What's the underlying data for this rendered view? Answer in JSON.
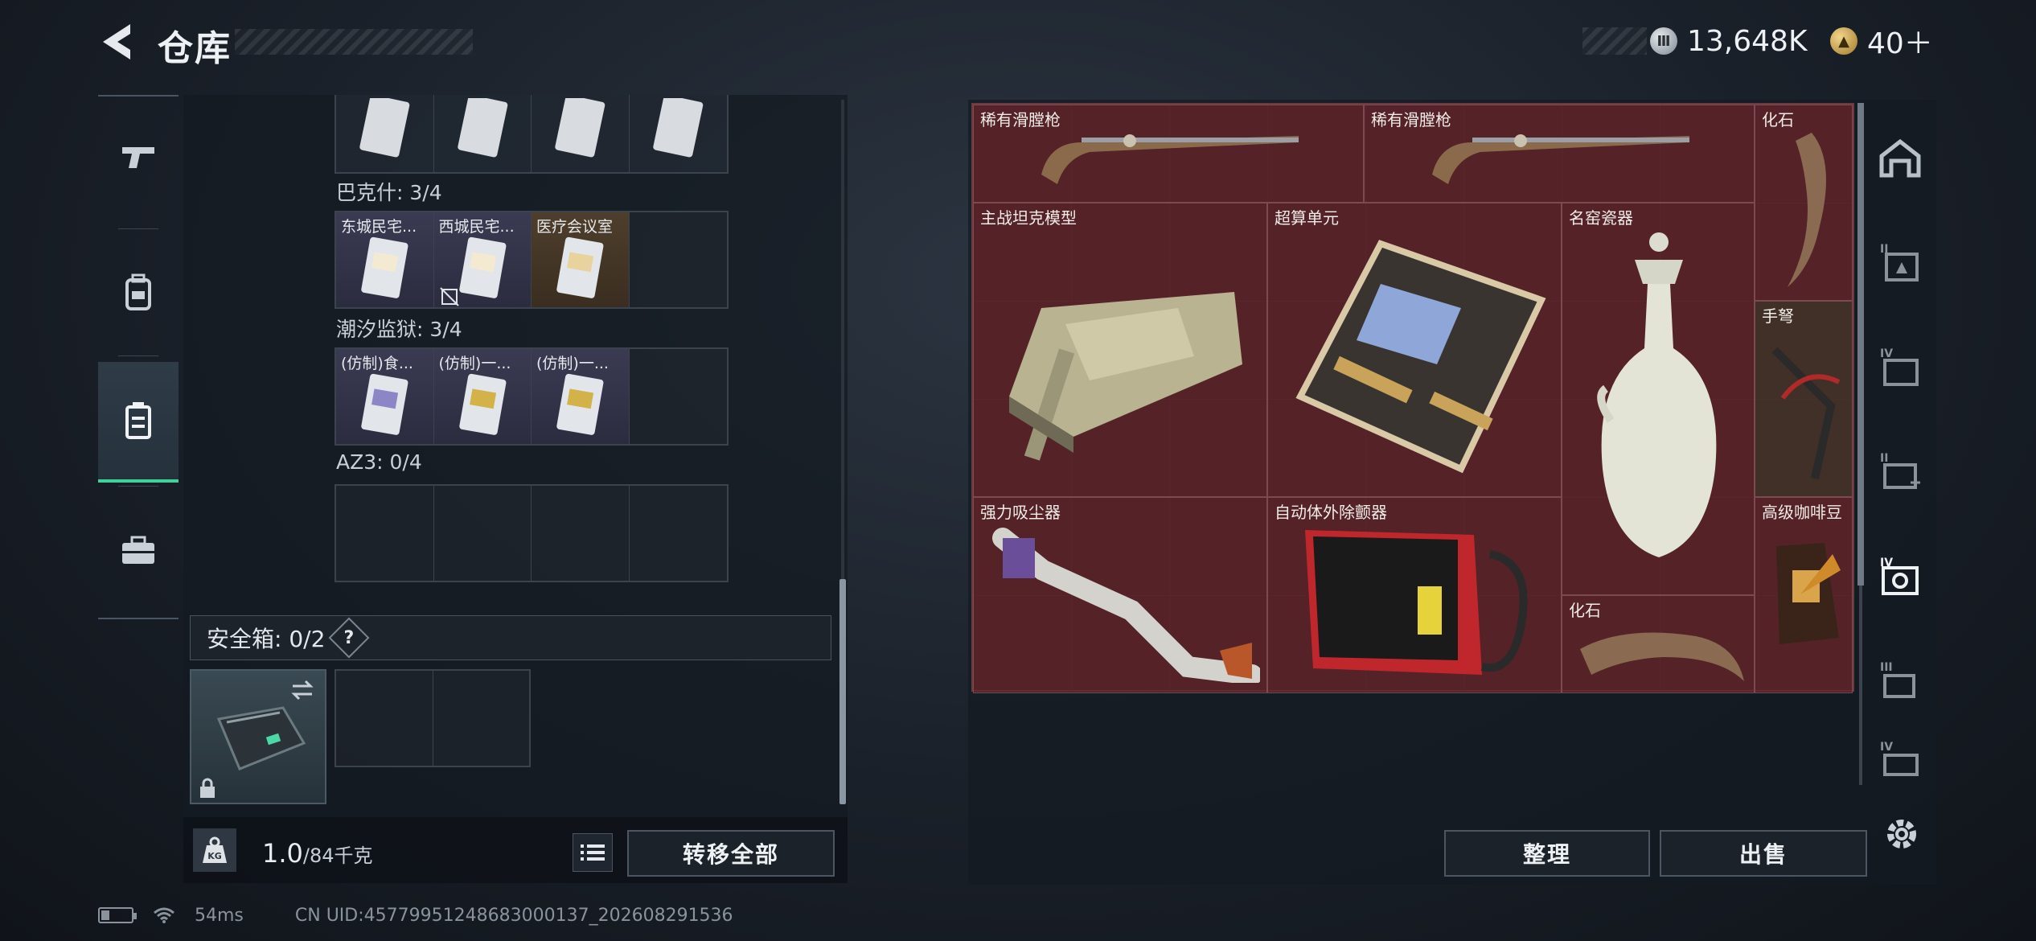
{
  "header": {
    "title": "仓库",
    "currency_money": "13,648K",
    "currency_ticket": "40＋"
  },
  "left_rail": {
    "items": [
      {
        "name": "weapons",
        "icon": "pistol-icon"
      },
      {
        "name": "equipment",
        "icon": "backpack-icon"
      },
      {
        "name": "container",
        "icon": "container-icon",
        "active": true
      },
      {
        "name": "cases",
        "icon": "toolbox-icon"
      }
    ]
  },
  "backpack": {
    "groups": [
      {
        "label": "巴克什: 3/4",
        "cells": [
          "东城民宅...",
          "西城民宅...",
          "医疗会议室",
          ""
        ]
      },
      {
        "label": "潮汐监狱: 3/4",
        "cells": [
          "(仿制)食...",
          "(仿制)一...",
          "(仿制)一...",
          ""
        ]
      },
      {
        "label": "AZ3: 0/4",
        "cells": [
          "",
          "",
          "",
          ""
        ]
      }
    ],
    "safe_box_label": "安全箱: 0/2",
    "safe_help": "?",
    "weight_value": "1.0",
    "weight_capacity": "/84千克",
    "transfer_all": "转移全部"
  },
  "stash": {
    "items": [
      {
        "label": "稀有滑膛枪",
        "icon": "musket-icon"
      },
      {
        "label": "稀有滑膛枪",
        "icon": "musket-icon"
      },
      {
        "label": "化石",
        "icon": "fossil-claw-icon"
      },
      {
        "label": "主战坦克模型",
        "icon": "tank-model-icon"
      },
      {
        "label": "超算单元",
        "icon": "circuit-board-icon"
      },
      {
        "label": "名窑瓷器",
        "icon": "porcelain-vase-icon"
      },
      {
        "label": "手弩",
        "icon": "crossbow-icon"
      },
      {
        "label": "强力吸尘器",
        "icon": "vacuum-cleaner-icon"
      },
      {
        "label": "自动体外除颤器",
        "icon": "defibrillator-icon"
      },
      {
        "label": "化石",
        "icon": "fossil-horn-icon"
      },
      {
        "label": "高级咖啡豆",
        "icon": "coffee-bag-icon"
      }
    ],
    "sort": "整理",
    "sell": "出售"
  },
  "right_rail": {
    "items": [
      "house-icon",
      "tier-ii-case-icon",
      "tier-iv-folder-icon",
      "tier-ii-medkit-icon",
      "tier-iv-photo-icon",
      "tier-iii-tool-icon",
      "tier-iv-vehicle-icon"
    ]
  },
  "status": {
    "ping": "54ms",
    "uid": "CN UID:457799512486830001​37_202608291536"
  },
  "colors": {
    "accent_green": "#3fd39b",
    "stash_bg": "#4e1f24"
  }
}
